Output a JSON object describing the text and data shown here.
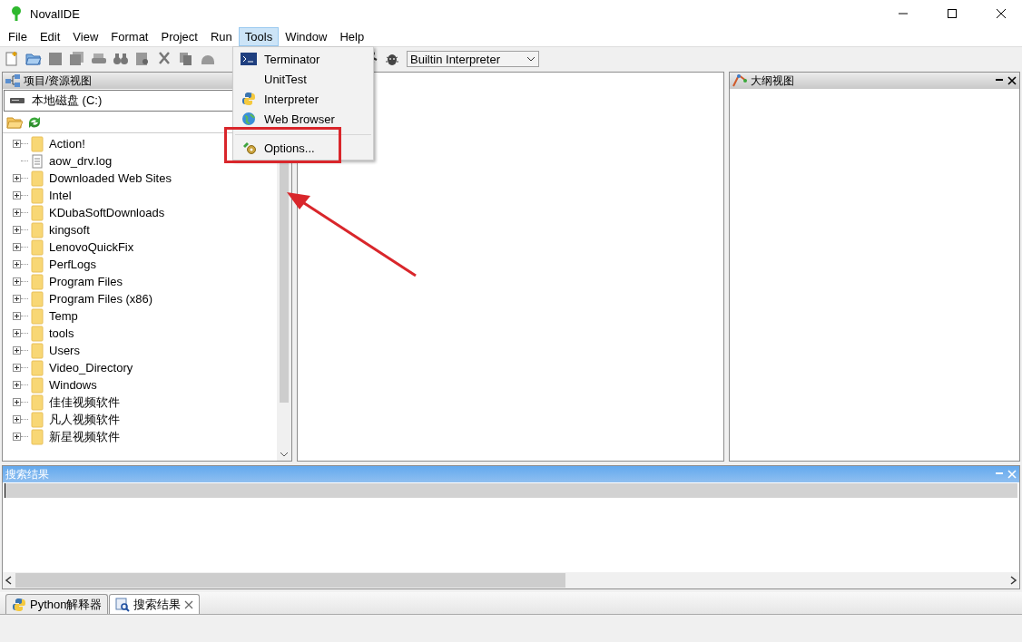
{
  "window": {
    "title": "NovalIDE"
  },
  "menu_bar": [
    {
      "label": "File",
      "selected": false
    },
    {
      "label": "Edit",
      "selected": false
    },
    {
      "label": "View",
      "selected": false
    },
    {
      "label": "Format",
      "selected": false
    },
    {
      "label": "Project",
      "selected": false
    },
    {
      "label": "Run",
      "selected": false
    },
    {
      "label": "Tools",
      "selected": true
    },
    {
      "label": "Window",
      "selected": false
    },
    {
      "label": "Help",
      "selected": false
    }
  ],
  "tools_menu": [
    {
      "label": "Terminator",
      "separator_before": false
    },
    {
      "label": "UnitTest",
      "separator_before": false
    },
    {
      "label": "Interpreter",
      "separator_before": false
    },
    {
      "label": "Web Browser",
      "separator_before": false
    },
    {
      "label": "Options...",
      "separator_before": true
    }
  ],
  "toolbar": {
    "interpreter_select": "Builtin Interpreter"
  },
  "project_panel": {
    "title": "项目/资源视图",
    "active": false,
    "drive": "本地磁盘 (C:)",
    "items": [
      {
        "label": "Action!",
        "kind": "folder",
        "expanded": false
      },
      {
        "label": "aow_drv.log",
        "kind": "file"
      },
      {
        "label": "Downloaded Web Sites",
        "kind": "folder",
        "expanded": false
      },
      {
        "label": "Intel",
        "kind": "folder",
        "expanded": false
      },
      {
        "label": "KDubaSoftDownloads",
        "kind": "folder",
        "expanded": false
      },
      {
        "label": "kingsoft",
        "kind": "folder",
        "expanded": false
      },
      {
        "label": "LenovoQuickFix",
        "kind": "folder",
        "expanded": false
      },
      {
        "label": "PerfLogs",
        "kind": "folder",
        "expanded": false
      },
      {
        "label": "Program Files",
        "kind": "folder",
        "expanded": false
      },
      {
        "label": "Program Files (x86)",
        "kind": "folder",
        "expanded": false
      },
      {
        "label": "Temp",
        "kind": "folder",
        "expanded": false
      },
      {
        "label": "tools",
        "kind": "folder",
        "expanded": false
      },
      {
        "label": "Users",
        "kind": "folder",
        "expanded": false
      },
      {
        "label": "Video_Directory",
        "kind": "folder",
        "expanded": false
      },
      {
        "label": "Windows",
        "kind": "folder",
        "expanded": false
      },
      {
        "label": "佳佳视频软件",
        "kind": "folder",
        "expanded": false
      },
      {
        "label": "凡人视频软件",
        "kind": "folder",
        "expanded": false
      },
      {
        "label": "新星视频软件",
        "kind": "folder",
        "expanded": false
      }
    ]
  },
  "outline_panel": {
    "title": "大纲视图",
    "active": false
  },
  "search_panel": {
    "title": "搜索结果",
    "active": true
  },
  "bottom_tabs": [
    {
      "label": "Python解释器",
      "selected": false,
      "closable": false
    },
    {
      "label": "搜索结果",
      "selected": true,
      "closable": true
    }
  ]
}
